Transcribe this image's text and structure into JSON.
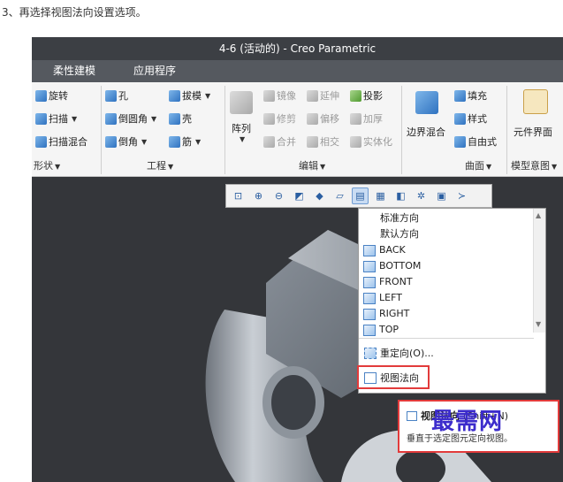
{
  "instruction": "3、再选择视图法向设置选项。",
  "window": {
    "title": "4-6 (活动的) - Creo Parametric"
  },
  "menu": {
    "tabs": [
      "柔性建模",
      "应用程序"
    ]
  },
  "ribbon": {
    "shape": {
      "items": [
        "旋转",
        "扫描",
        "扫描混合"
      ],
      "label": "形状"
    },
    "engineering": {
      "items": [
        "孔",
        "倒圆角",
        "倒角",
        "拔模",
        "壳",
        "筋"
      ],
      "label": "工程"
    },
    "edit": {
      "pattern": "阵列",
      "items": [
        "镜像",
        "延伸",
        "投影",
        "修剪",
        "偏移",
        "加厚",
        "合并",
        "相交",
        "实体化"
      ],
      "label": "编辑"
    },
    "surface": {
      "boundary": "边界混合",
      "items": [
        "填充",
        "样式",
        "自由式"
      ],
      "label": "曲面"
    },
    "model_intent": {
      "item": "元件界面",
      "label": "模型意图"
    }
  },
  "view_menu": {
    "headers": [
      "标准方向",
      "默认方向"
    ],
    "views": [
      "BACK",
      "BOTTOM",
      "FRONT",
      "LEFT",
      "RIGHT",
      "TOP"
    ],
    "reorient": "重定向(O)...",
    "view_normal": "视图法向"
  },
  "tooltip": {
    "title": "视图法向",
    "shortcut": "(Shift+N)",
    "description": "垂直于选定图元定向视图。"
  },
  "watermark": "最需网",
  "colors": {
    "highlight": "#e23b3b",
    "watermark": "#3c2ccc",
    "titlebar": "#3c3f44",
    "menubar": "#55595f"
  }
}
